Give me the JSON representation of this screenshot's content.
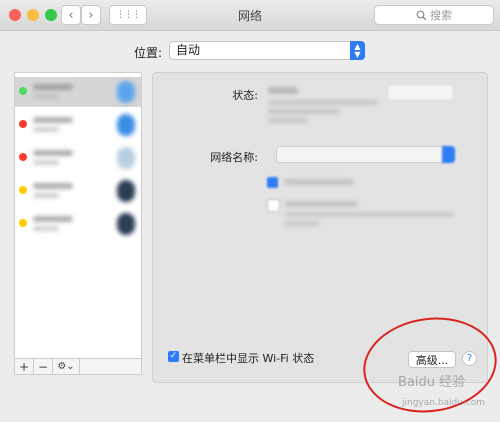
{
  "window": {
    "title": "网络",
    "search_placeholder": "搜索",
    "back_glyph": "‹",
    "forward_glyph": "›",
    "grid_glyph": "⋮⋮⋮"
  },
  "location": {
    "label": "位置:",
    "value": "自动",
    "arrows": "⌃⌄"
  },
  "services": [
    {
      "dot_color": "#4cd964",
      "icon_color": "#5aa6ee",
      "selected": true
    },
    {
      "dot_color": "#ff3b30",
      "icon_color": "#3a8ee6",
      "selected": false
    },
    {
      "dot_color": "#ff3b30",
      "icon_color": "#b8cde0",
      "selected": false
    },
    {
      "dot_color": "#ffcc00",
      "icon_color": "#2b3c55",
      "selected": false
    },
    {
      "dot_color": "#ffcc00",
      "icon_color": "#2b3c55",
      "selected": false
    }
  ],
  "sidebar_tools": {
    "add": "+",
    "remove": "−",
    "gear": "⚙︎⌄"
  },
  "panel": {
    "status_label": "状态:",
    "network_name_label": "网络名称:"
  },
  "bottom": {
    "show_wifi_checked": true,
    "checkmark": "✓",
    "show_wifi_label": "在菜单栏中显示 Wi-Fi 状态",
    "advanced_label": "高级...",
    "help_glyph": "?"
  },
  "watermark": {
    "text": "Baidu 经验",
    "url": "jingyan.baidu.com"
  },
  "colors": {
    "accent": "#2f7df6",
    "annotation_circle": "#d8251f"
  }
}
